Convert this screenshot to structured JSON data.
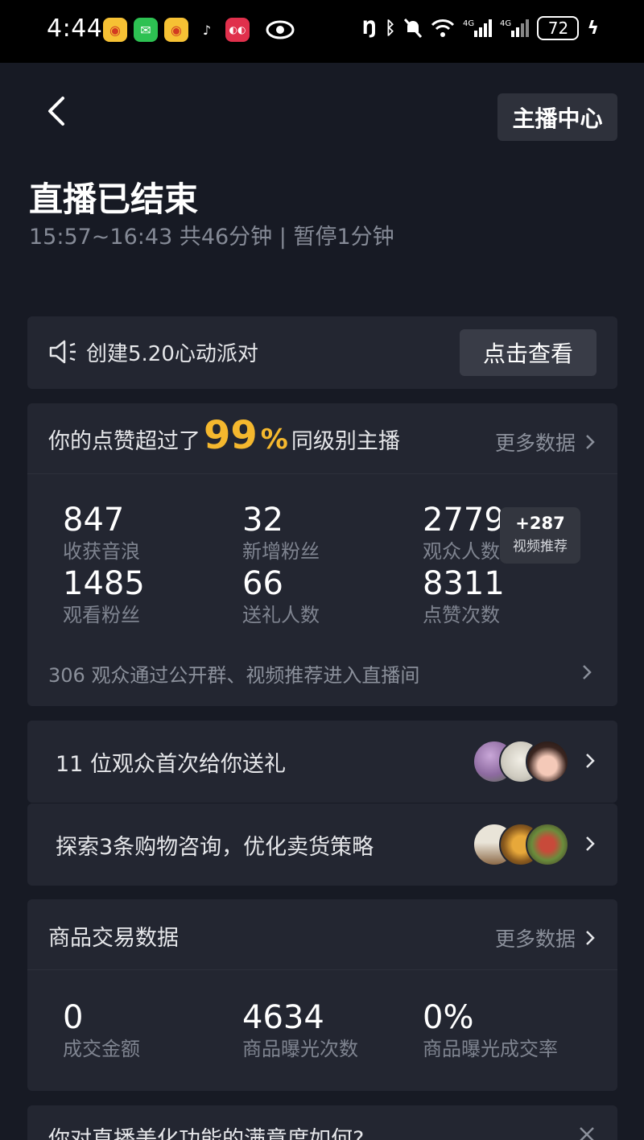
{
  "status_bar": {
    "time": "4:44",
    "battery": "72",
    "apps": [
      "weibo-icon",
      "wechat-icon",
      "weibo-icon",
      "tiktok-icon",
      "app-icon"
    ]
  },
  "header": {
    "host_center_label": "主播中心",
    "title": "直播已结束",
    "session_time": "15:57~16:43 共46分钟 | 暂停1分钟"
  },
  "banner": {
    "text": "创建5.20心动派对",
    "button_label": "点击查看"
  },
  "stats": {
    "likes_prefix": "你的点赞超过了",
    "likes_percent": "99",
    "likes_percent_sign": "%",
    "likes_suffix": "同级别主播",
    "more_label": "更多数据",
    "metrics": [
      {
        "value": "847",
        "label": "收获音浪"
      },
      {
        "value": "32",
        "label": "新增粉丝"
      },
      {
        "value": "2779",
        "label": "观众人数"
      },
      {
        "value": "1485",
        "label": "观看粉丝"
      },
      {
        "value": "66",
        "label": "送礼人数"
      },
      {
        "value": "8311",
        "label": "点赞次数"
      }
    ],
    "badge": {
      "value": "+287",
      "label": "视频推荐"
    },
    "source_text": "306 观众通过公开群、视频推荐进入直播间"
  },
  "gift_row": {
    "text": "11 位观众首次给你送礼"
  },
  "shop_row": {
    "text": "探索3条购物咨询，优化卖货策略"
  },
  "trade": {
    "title": "商品交易数据",
    "more_label": "更多数据",
    "metrics": [
      {
        "value": "0",
        "label": "成交金额"
      },
      {
        "value": "4634",
        "label": "商品曝光次数"
      },
      {
        "value": "0%",
        "label": "商品曝光成交率"
      }
    ]
  },
  "survey": {
    "text": "你对直播美化功能的满意度如何?"
  },
  "colors": {
    "background": "#171a24",
    "card": "#232631",
    "accent": "#f5b82e",
    "muted_text": "#858a96"
  }
}
